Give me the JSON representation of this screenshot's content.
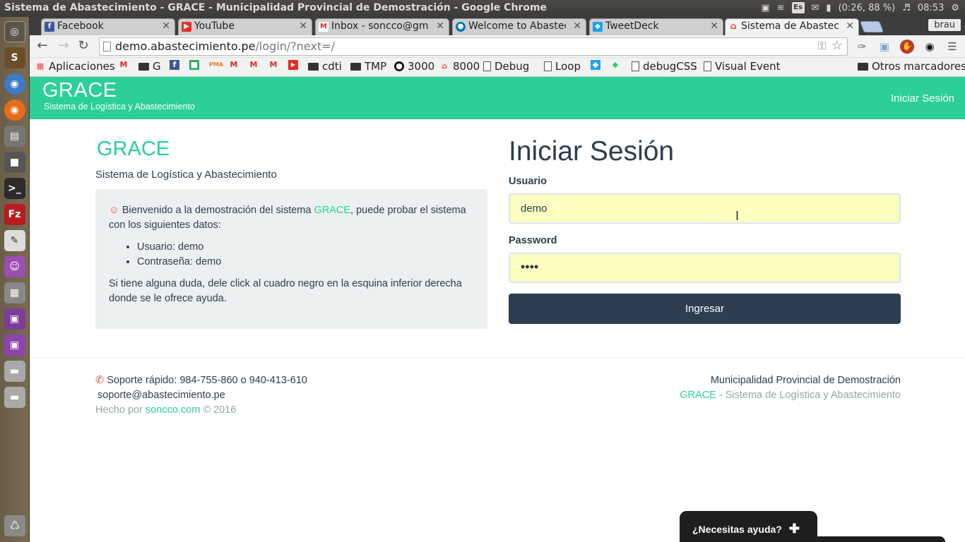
{
  "os": {
    "window_title": "Sistema de Abastecimiento - GRACE - Municipalidad Provincial de Demostración - Google Chrome",
    "keyboard_layout": "Es",
    "battery": "(0:26, 88 %)",
    "clock": "08:53"
  },
  "browser": {
    "tabs": [
      {
        "label": "Facebook",
        "favicon": "facebook-icon",
        "color": "#3b5998"
      },
      {
        "label": "YouTube",
        "favicon": "youtube-icon",
        "color": "#e52d27"
      },
      {
        "label": "Inbox - soncco@gma",
        "favicon": "gmail-icon",
        "color": "#d93025"
      },
      {
        "label": "Welcome to Abastec",
        "favicon": "drupal-icon",
        "color": "#0077c0"
      },
      {
        "label": "TweetDeck",
        "favicon": "tweetdeck-icon",
        "color": "#1da1f2"
      },
      {
        "label": "Sistema de Abastecin",
        "favicon": "house-icon",
        "color": "#e74c3c"
      }
    ],
    "profile": "brau",
    "url_host": "demo.abastecimiento.pe",
    "url_path": "/login/?next=/",
    "bookmarks": [
      "Aplicaciones",
      "G",
      "cdti",
      "TMP",
      "3000",
      "8000",
      "Debug",
      "Loop",
      "debugCSS",
      "Visual Event",
      "Otros marcadores"
    ]
  },
  "navbar": {
    "brand": "GRACE",
    "brand_sub": "Sistema de Logística y Abastecimiento",
    "login_link": "Iniciar Sesión"
  },
  "info": {
    "title": "GRACE",
    "subtitle": "Sistema de Logística y Abastecimiento",
    "welcome_pre": "Bienvenido a la demostración del sistema ",
    "welcome_link": "GRACE",
    "welcome_post": ", puede probar el sistema con los siguientes datos:",
    "credentials": [
      "Usuario: demo",
      "Contraseña: demo"
    ],
    "help_text": "Si tiene alguna duda, dele click al cuadro negro en la esquina inferior derecha donde se le ofrece ayuda."
  },
  "login": {
    "title": "Iniciar Sesión",
    "user_label": "Usuario",
    "user_value": "demo",
    "password_label": "Password",
    "password_value": "••••",
    "submit": "Ingresar"
  },
  "footer": {
    "support": "Soporte rápido: 984-755-860 o 940-413-610",
    "email": "soporte@abastecimiento.pe",
    "made_by": "Hecho por ",
    "made_link": "soncco.com",
    "year": " © 2016",
    "org": "Municipalidad Provincial de Demostración",
    "grace": "GRACE",
    "grace_sub": " - Sistema de Logística y Abastecimiento"
  },
  "help_widget": {
    "label": "¿Necesitas ayuda?",
    "icon": "plus-icon"
  },
  "colors": {
    "accent": "#2bcf97",
    "dark": "#2c3e50",
    "input_bg": "#fcffc0",
    "panel_bg": "#ecf0f1"
  }
}
